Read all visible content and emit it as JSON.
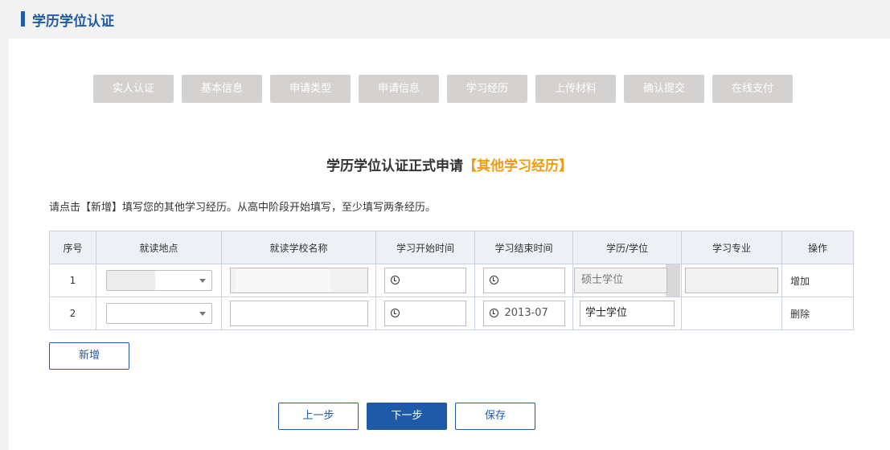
{
  "header": {
    "title": "学历学位认证"
  },
  "steps": [
    "实人认证",
    "基本信息",
    "申请类型",
    "申请信息",
    "学习经历",
    "上传材料",
    "确认提交",
    "在线支付"
  ],
  "form": {
    "title": "学历学位认证正式申请",
    "title_highlight": "【其他学习经历】",
    "instruction": "请点击【新增】填写您的其他学习经历。从高中阶段开始填写，至少填写两条经历。"
  },
  "table": {
    "headers": [
      "序号",
      "就读地点",
      "就读学校名称",
      "学习开始时间",
      "学习结束时间",
      "学历/学位",
      "学习专业",
      "操作"
    ],
    "rows": [
      {
        "index": "1",
        "start": "",
        "end": "",
        "degree": "硕士学位",
        "action": "增加"
      },
      {
        "index": "2",
        "start": "",
        "end": "2013-07",
        "degree": "学士学位",
        "action": "删除"
      }
    ]
  },
  "buttons": {
    "add": "新增",
    "prev": "上一步",
    "next": "下一步",
    "save": "保存"
  },
  "colors": {
    "accent": "#1e5aa8",
    "highlight": "#f29b0d",
    "step_bg": "#d4d2d0"
  }
}
